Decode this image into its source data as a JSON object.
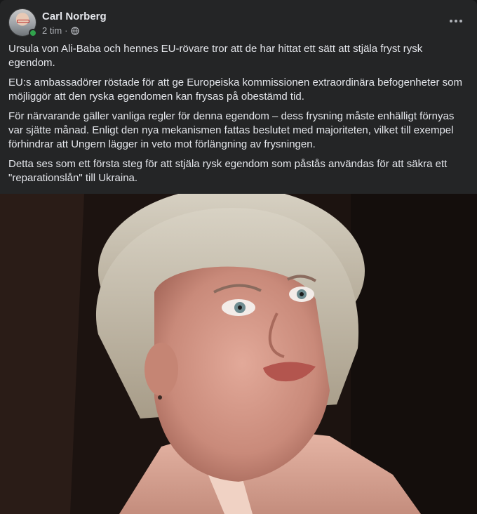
{
  "post": {
    "author": "Carl Norberg",
    "time": "2 tim",
    "privacy_icon": "globe-icon",
    "paragraphs": [
      "Ursula von Ali-Baba och hennes EU-rövare tror att de har hittat ett sätt att stjäla fryst rysk egendom.",
      "EU:s ambassadörer röstade för att ge Europeiska kommissionen extraordinära befogenheter som möjliggör att den ryska egendomen kan frysas på obestämd tid.",
      "För närvarande gäller vanliga regler för denna egendom – dess frysning måste enhälligt förnyas var sjätte månad. Enligt den nya mekanismen fattas beslutet med majoriteten, vilket till exempel förhindrar att Ungern lägger in veto mot förlängning av frysningen.",
      "Detta ses som ett första steg för att stjäla rysk egendom som påstås användas för att säkra ett \"reparationslån\" till Ukraina."
    ]
  },
  "colors": {
    "card_bg": "#242526",
    "text": "#e4e6eb",
    "secondary_text": "#b0b3b8",
    "online": "#31a24c"
  }
}
